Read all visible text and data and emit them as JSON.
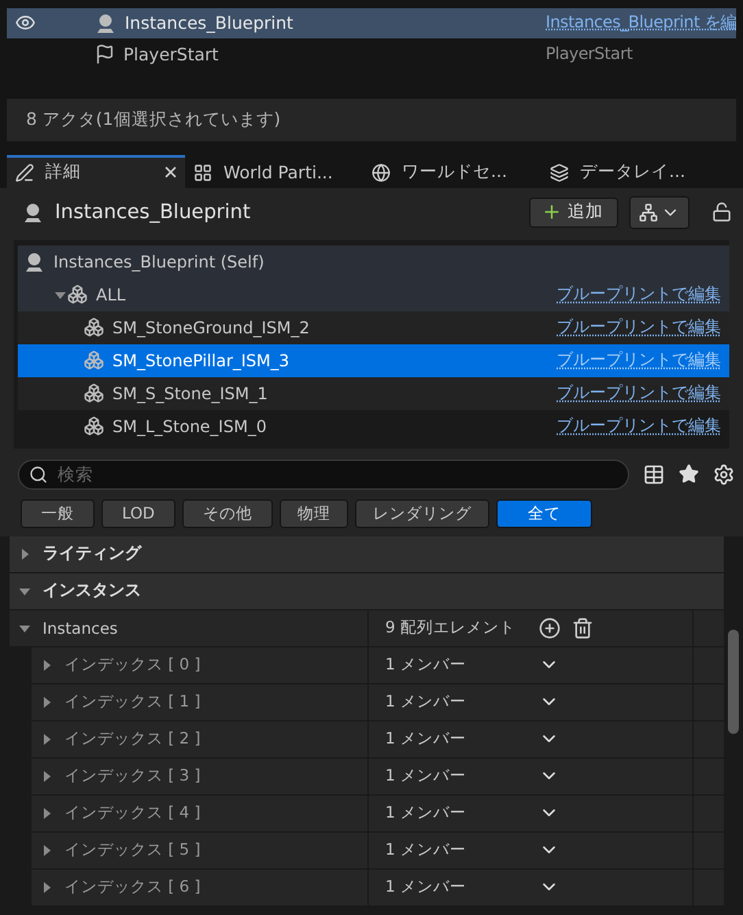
{
  "outliner": {
    "rows": [
      {
        "name": "Instances_Blueprint",
        "type": "Instances_Blueprint を編",
        "selected": true,
        "kind": "actor"
      },
      {
        "name": "PlayerStart",
        "type": "PlayerStart",
        "selected": false,
        "kind": "player"
      }
    ]
  },
  "status_bar": "8 アクタ(1個選択されています)",
  "tabs": [
    {
      "label": "詳細",
      "selected": true,
      "kind": "details",
      "closable": true
    },
    {
      "label": "World Parti...",
      "selected": false,
      "kind": "partition",
      "closable": false
    },
    {
      "label": "ワールドセ...",
      "selected": false,
      "kind": "world",
      "closable": false
    },
    {
      "label": "データレイ...",
      "selected": false,
      "kind": "layers",
      "closable": false
    }
  ],
  "header": {
    "title": "Instances_Blueprint",
    "add_button": "追加"
  },
  "components": [
    {
      "name": "Instances_Blueprint (Self)",
      "kind": "actor",
      "selected": false,
      "children": [
        {
          "name": "ALL",
          "kind": "component",
          "selected": false,
          "expanded": true,
          "link": "ブループリントで編集",
          "children": [
            {
              "name": "SM_StoneGround_ISM_2",
              "kind": "component",
              "selected": false,
              "link": "ブループリントで編集"
            },
            {
              "name": "SM_StonePillar_ISM_3",
              "kind": "component",
              "selected": true,
              "link": "ブループリントで編集"
            },
            {
              "name": "SM_S_Stone_ISM_1",
              "kind": "component",
              "selected": false,
              "link": "ブループリントで編集"
            },
            {
              "name": "SM_L_Stone_ISM_0",
              "kind": "component",
              "selected": false,
              "link": "ブループリントで編集"
            }
          ]
        }
      ]
    }
  ],
  "search": {
    "placeholder": "検索"
  },
  "filters": [
    {
      "label": "一般",
      "selected": false
    },
    {
      "label": "LOD",
      "selected": false
    },
    {
      "label": "その他",
      "selected": false
    },
    {
      "label": "物理",
      "selected": false
    },
    {
      "label": "レンダリング",
      "selected": false
    },
    {
      "label": "全て",
      "selected": true
    }
  ],
  "categories": [
    {
      "title": "ライティング",
      "expanded": false
    },
    {
      "title": "インスタンス",
      "expanded": true,
      "properties": [
        {
          "name": "Instances",
          "value": "9 配列エレメント",
          "expanded": true,
          "children": [
            {
              "name": "インデックス [ 0 ]",
              "value": "1 メンバー",
              "expanded": false
            },
            {
              "name": "インデックス [ 1 ]",
              "value": "1 メンバー",
              "expanded": false
            },
            {
              "name": "インデックス [ 2 ]",
              "value": "1 メンバー",
              "expanded": false
            },
            {
              "name": "インデックス [ 3 ]",
              "value": "1 メンバー",
              "expanded": false
            },
            {
              "name": "インデックス [ 4 ]",
              "value": "1 メンバー",
              "expanded": false
            },
            {
              "name": "インデックス [ 5 ]",
              "value": "1 メンバー",
              "expanded": false
            },
            {
              "name": "インデックス [ 6 ]",
              "value": "1 メンバー",
              "expanded": false
            }
          ]
        }
      ]
    }
  ]
}
